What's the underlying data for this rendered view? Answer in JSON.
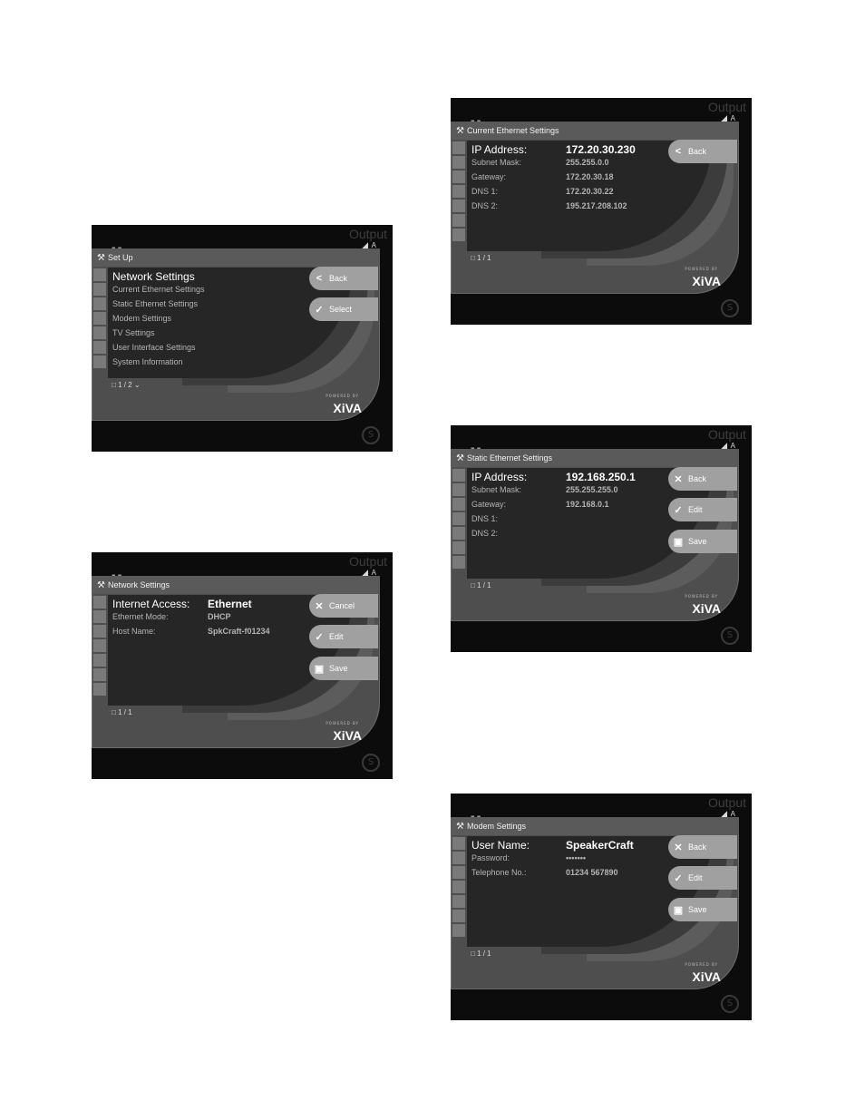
{
  "common": {
    "output_label": "Output",
    "zone_label": "A",
    "powered_by": "POWERED BY",
    "brand": "XiVA"
  },
  "screens": [
    {
      "title": "Set Up",
      "rows": [
        {
          "label": "Network Settings",
          "value": ""
        },
        {
          "label": "Current Ethernet Settings",
          "value": ""
        },
        {
          "label": "Static Ethernet Settings",
          "value": ""
        },
        {
          "label": "Modem Settings",
          "value": ""
        },
        {
          "label": "TV Settings",
          "value": ""
        },
        {
          "label": "User Interface Settings",
          "value": ""
        },
        {
          "label": "System Information",
          "value": ""
        }
      ],
      "buttons": [
        {
          "label": "Back",
          "icon": "back-arrow-icon"
        },
        {
          "label": "Select",
          "icon": "check-icon"
        }
      ],
      "pager": "1 / 2"
    },
    {
      "title": "Network Settings",
      "rows": [
        {
          "label": "Internet Access:",
          "value": "Ethernet"
        },
        {
          "label": "Ethernet Mode:",
          "value": "DHCP"
        },
        {
          "label": "Host Name:",
          "value": "SpkCraft-f01234"
        }
      ],
      "buttons": [
        {
          "label": "Cancel",
          "icon": "cross-icon"
        },
        {
          "label": "Edit",
          "icon": "check-icon"
        },
        {
          "label": "Save",
          "icon": "save-icon"
        }
      ],
      "pager": "1 / 1"
    },
    {
      "title": "Current Ethernet Settings",
      "rows": [
        {
          "label": "IP Address:",
          "value": "172.20.30.230"
        },
        {
          "label": "Subnet Mask:",
          "value": "255.255.0.0"
        },
        {
          "label": "Gateway:",
          "value": "172.20.30.18"
        },
        {
          "label": "DNS 1:",
          "value": "172.20.30.22"
        },
        {
          "label": "DNS 2:",
          "value": "195.217.208.102"
        }
      ],
      "buttons": [
        {
          "label": "Back",
          "icon": "back-arrow-icon"
        }
      ],
      "pager": "1 / 1"
    },
    {
      "title": "Static Ethernet Settings",
      "rows": [
        {
          "label": "IP Address:",
          "value": "192.168.250.1"
        },
        {
          "label": "Subnet Mask:",
          "value": "255.255.255.0"
        },
        {
          "label": "Gateway:",
          "value": "192.168.0.1"
        },
        {
          "label": "DNS 1:",
          "value": ""
        },
        {
          "label": "DNS 2:",
          "value": ""
        }
      ],
      "buttons": [
        {
          "label": "Back",
          "icon": "cross-icon"
        },
        {
          "label": "Edit",
          "icon": "check-icon"
        },
        {
          "label": "Save",
          "icon": "save-icon"
        }
      ],
      "pager": "1 / 1"
    },
    {
      "title": "Modem Settings",
      "rows": [
        {
          "label": "User Name:",
          "value": "SpeakerCraft"
        },
        {
          "label": "Password:",
          "value": "•••••••"
        },
        {
          "label": "Telephone No.:",
          "value": "01234 567890"
        }
      ],
      "buttons": [
        {
          "label": "Back",
          "icon": "cross-icon"
        },
        {
          "label": "Edit",
          "icon": "check-icon"
        },
        {
          "label": "Save",
          "icon": "save-icon"
        }
      ],
      "pager": "1 / 1"
    }
  ]
}
